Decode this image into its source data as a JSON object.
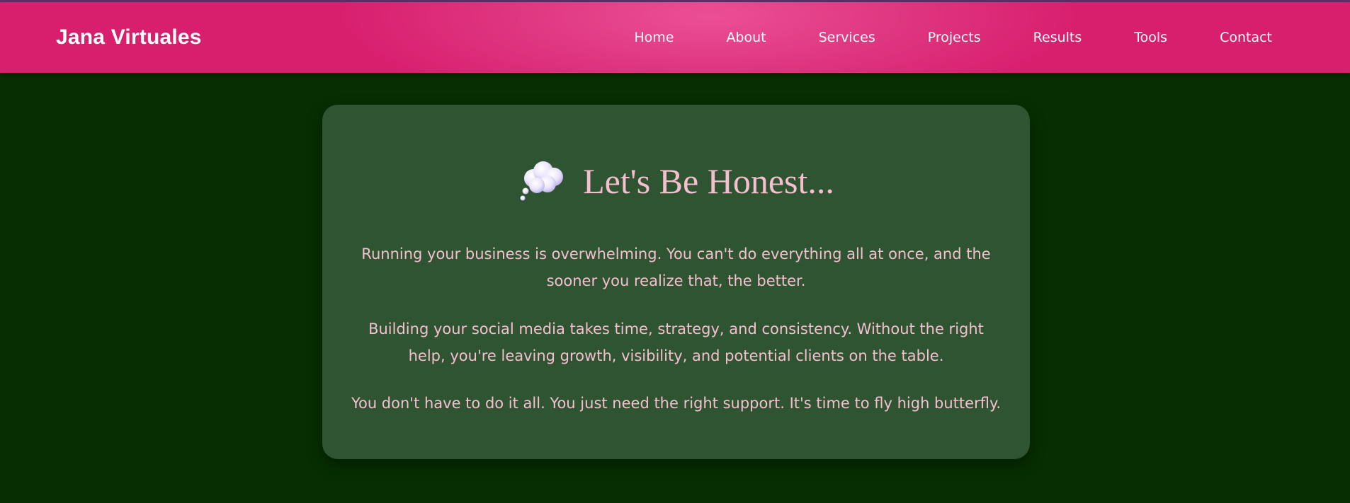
{
  "header": {
    "brand": "Jana Virtuales",
    "nav": [
      "Home",
      "About",
      "Services",
      "Projects",
      "Results",
      "Tools",
      "Contact"
    ]
  },
  "main": {
    "headline_icon": "thought-bubble-icon",
    "headline": "Let's Be Honest...",
    "paragraphs": [
      "Running your business is overwhelming. You can't do everything all at once, and the sooner you realize that, the better.",
      "Building your social media takes time, strategy, and consistency. Without the right help, you're leaving growth, visibility, and potential clients on the table.",
      "You don't have to do it all. You just need the right support.  It's time to fly high butterfly."
    ]
  },
  "colors": {
    "header_pink": "#e03a83",
    "page_green": "#062e02",
    "card_green": "#2f5432",
    "text_pink": "#f6bfcf"
  }
}
